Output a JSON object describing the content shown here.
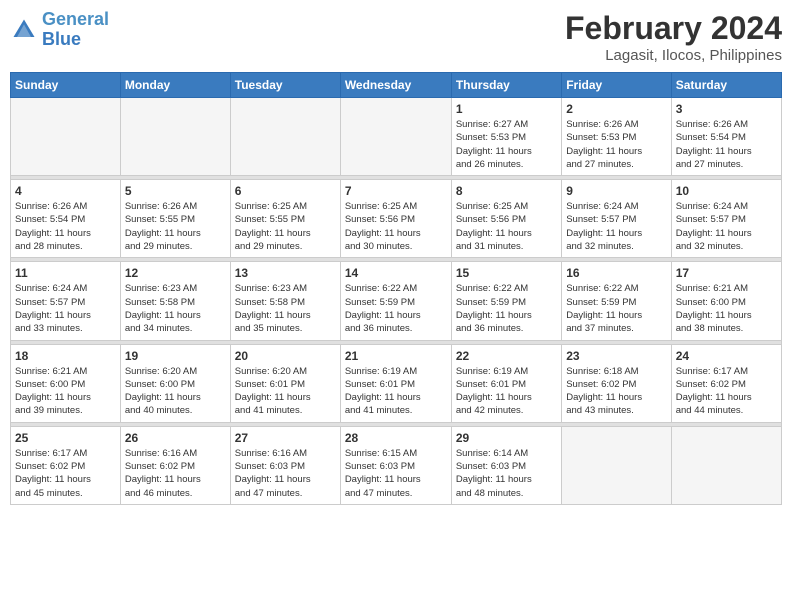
{
  "header": {
    "logo_line1": "General",
    "logo_line2": "Blue",
    "month_year": "February 2024",
    "location": "Lagasit, Ilocos, Philippines"
  },
  "weekdays": [
    "Sunday",
    "Monday",
    "Tuesday",
    "Wednesday",
    "Thursday",
    "Friday",
    "Saturday"
  ],
  "weeks": [
    [
      {
        "day": "",
        "info": ""
      },
      {
        "day": "",
        "info": ""
      },
      {
        "day": "",
        "info": ""
      },
      {
        "day": "",
        "info": ""
      },
      {
        "day": "1",
        "info": "Sunrise: 6:27 AM\nSunset: 5:53 PM\nDaylight: 11 hours\nand 26 minutes."
      },
      {
        "day": "2",
        "info": "Sunrise: 6:26 AM\nSunset: 5:53 PM\nDaylight: 11 hours\nand 27 minutes."
      },
      {
        "day": "3",
        "info": "Sunrise: 6:26 AM\nSunset: 5:54 PM\nDaylight: 11 hours\nand 27 minutes."
      }
    ],
    [
      {
        "day": "4",
        "info": "Sunrise: 6:26 AM\nSunset: 5:54 PM\nDaylight: 11 hours\nand 28 minutes."
      },
      {
        "day": "5",
        "info": "Sunrise: 6:26 AM\nSunset: 5:55 PM\nDaylight: 11 hours\nand 29 minutes."
      },
      {
        "day": "6",
        "info": "Sunrise: 6:25 AM\nSunset: 5:55 PM\nDaylight: 11 hours\nand 29 minutes."
      },
      {
        "day": "7",
        "info": "Sunrise: 6:25 AM\nSunset: 5:56 PM\nDaylight: 11 hours\nand 30 minutes."
      },
      {
        "day": "8",
        "info": "Sunrise: 6:25 AM\nSunset: 5:56 PM\nDaylight: 11 hours\nand 31 minutes."
      },
      {
        "day": "9",
        "info": "Sunrise: 6:24 AM\nSunset: 5:57 PM\nDaylight: 11 hours\nand 32 minutes."
      },
      {
        "day": "10",
        "info": "Sunrise: 6:24 AM\nSunset: 5:57 PM\nDaylight: 11 hours\nand 32 minutes."
      }
    ],
    [
      {
        "day": "11",
        "info": "Sunrise: 6:24 AM\nSunset: 5:57 PM\nDaylight: 11 hours\nand 33 minutes."
      },
      {
        "day": "12",
        "info": "Sunrise: 6:23 AM\nSunset: 5:58 PM\nDaylight: 11 hours\nand 34 minutes."
      },
      {
        "day": "13",
        "info": "Sunrise: 6:23 AM\nSunset: 5:58 PM\nDaylight: 11 hours\nand 35 minutes."
      },
      {
        "day": "14",
        "info": "Sunrise: 6:22 AM\nSunset: 5:59 PM\nDaylight: 11 hours\nand 36 minutes."
      },
      {
        "day": "15",
        "info": "Sunrise: 6:22 AM\nSunset: 5:59 PM\nDaylight: 11 hours\nand 36 minutes."
      },
      {
        "day": "16",
        "info": "Sunrise: 6:22 AM\nSunset: 5:59 PM\nDaylight: 11 hours\nand 37 minutes."
      },
      {
        "day": "17",
        "info": "Sunrise: 6:21 AM\nSunset: 6:00 PM\nDaylight: 11 hours\nand 38 minutes."
      }
    ],
    [
      {
        "day": "18",
        "info": "Sunrise: 6:21 AM\nSunset: 6:00 PM\nDaylight: 11 hours\nand 39 minutes."
      },
      {
        "day": "19",
        "info": "Sunrise: 6:20 AM\nSunset: 6:00 PM\nDaylight: 11 hours\nand 40 minutes."
      },
      {
        "day": "20",
        "info": "Sunrise: 6:20 AM\nSunset: 6:01 PM\nDaylight: 11 hours\nand 41 minutes."
      },
      {
        "day": "21",
        "info": "Sunrise: 6:19 AM\nSunset: 6:01 PM\nDaylight: 11 hours\nand 41 minutes."
      },
      {
        "day": "22",
        "info": "Sunrise: 6:19 AM\nSunset: 6:01 PM\nDaylight: 11 hours\nand 42 minutes."
      },
      {
        "day": "23",
        "info": "Sunrise: 6:18 AM\nSunset: 6:02 PM\nDaylight: 11 hours\nand 43 minutes."
      },
      {
        "day": "24",
        "info": "Sunrise: 6:17 AM\nSunset: 6:02 PM\nDaylight: 11 hours\nand 44 minutes."
      }
    ],
    [
      {
        "day": "25",
        "info": "Sunrise: 6:17 AM\nSunset: 6:02 PM\nDaylight: 11 hours\nand 45 minutes."
      },
      {
        "day": "26",
        "info": "Sunrise: 6:16 AM\nSunset: 6:02 PM\nDaylight: 11 hours\nand 46 minutes."
      },
      {
        "day": "27",
        "info": "Sunrise: 6:16 AM\nSunset: 6:03 PM\nDaylight: 11 hours\nand 47 minutes."
      },
      {
        "day": "28",
        "info": "Sunrise: 6:15 AM\nSunset: 6:03 PM\nDaylight: 11 hours\nand 47 minutes."
      },
      {
        "day": "29",
        "info": "Sunrise: 6:14 AM\nSunset: 6:03 PM\nDaylight: 11 hours\nand 48 minutes."
      },
      {
        "day": "",
        "info": ""
      },
      {
        "day": "",
        "info": ""
      }
    ]
  ]
}
